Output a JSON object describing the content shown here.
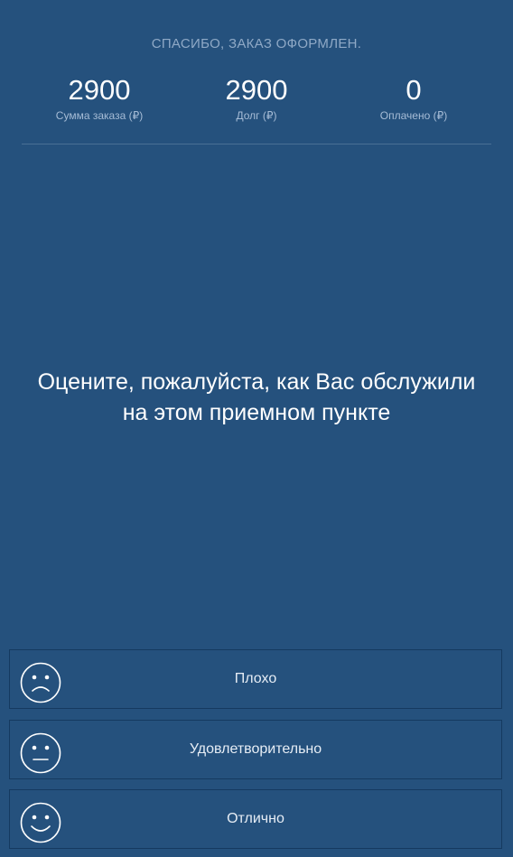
{
  "header": {
    "title": "СПАСИБО, ЗАКАЗ ОФОРМЛЕН."
  },
  "stats": [
    {
      "value": "2900",
      "label": "Сумма заказа (₽)"
    },
    {
      "value": "2900",
      "label": "Долг (₽)"
    },
    {
      "value": "0",
      "label": "Оплачено (₽)"
    }
  ],
  "prompt": {
    "line1": "Оцените, пожалуйста, как Вас обслужили",
    "line2": "на этом приемном пункте"
  },
  "ratings": [
    {
      "label": "Плохо",
      "icon": "sad-face-icon"
    },
    {
      "label": "Удовлетворительно",
      "icon": "neutral-face-icon"
    },
    {
      "label": "Отлично",
      "icon": "happy-face-icon"
    }
  ],
  "colors": {
    "background": "#25517d",
    "muted_text": "#8fa9c6",
    "divider": "#4a6f95"
  }
}
